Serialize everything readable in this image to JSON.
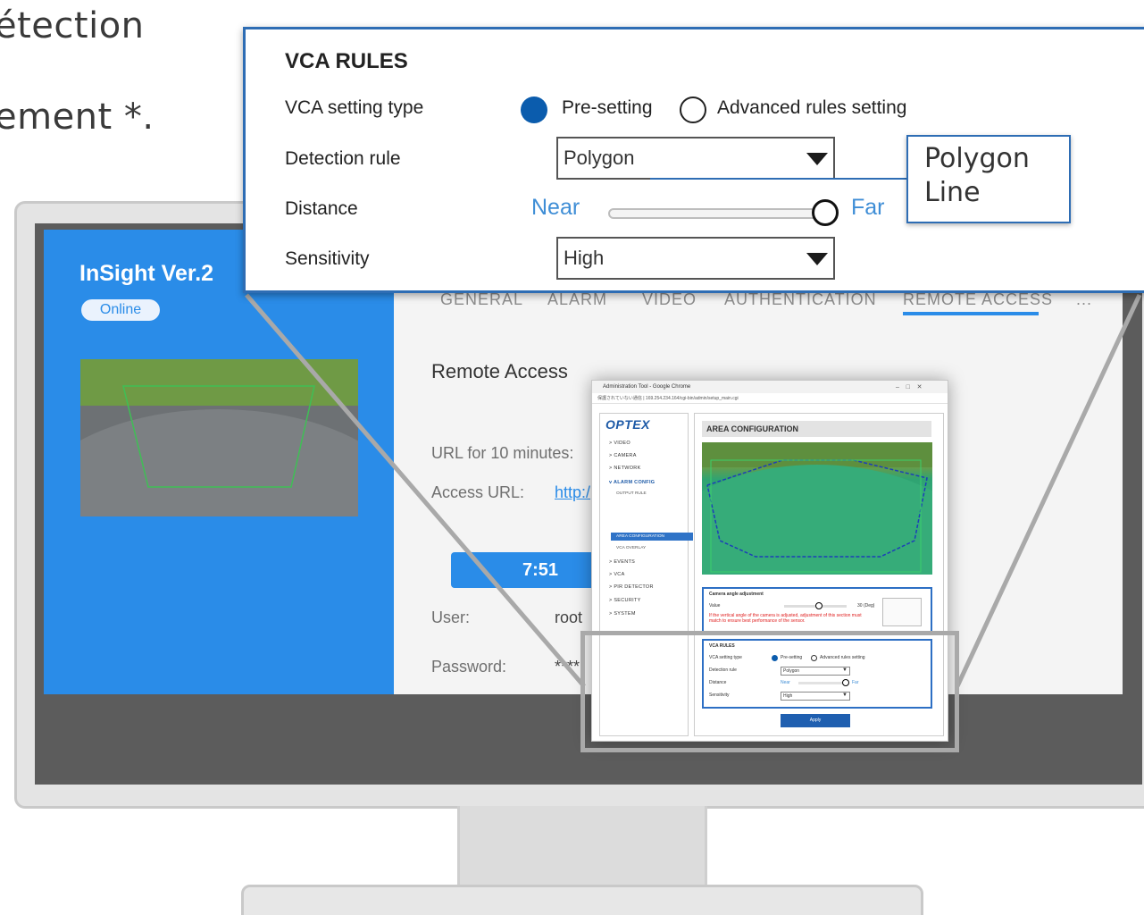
{
  "background": {
    "text_line1": "étection",
    "text_line2": "ement *."
  },
  "app": {
    "title": "InSight Ver.2",
    "status": "Online",
    "tabs": [
      "GENERAL",
      "ALARM",
      "VIDEO",
      "AUTHENTICATION",
      "REMOTE ACCESS",
      "..."
    ],
    "section_title": "Remote Access",
    "url_label": "URL for 10 minutes:",
    "access_url_label": "Access URL:",
    "access_url_value": "http:/",
    "timer": "7:51",
    "user_label": "User:",
    "user_value": "root",
    "password_label": "Password:",
    "password_value": "****"
  },
  "browser": {
    "window_title": "Administration Tool - Google Chrome",
    "address": "保護されていない通信 | 169.254.234.164/cgi-bin/admin/setup_main.cgi",
    "logo": "OPTEX",
    "nav": [
      {
        "label": "> VIDEO",
        "sub": false
      },
      {
        "label": "> CAMERA",
        "sub": false
      },
      {
        "label": "> NETWORK",
        "sub": false
      },
      {
        "label": "v ALARM CONFIG",
        "sub": false
      },
      {
        "label": "OUTPUT RULE",
        "sub": true
      },
      {
        "label": "AREA CONFIGURATION",
        "sub": true
      },
      {
        "label": "VCA OVERLAY",
        "sub": true
      },
      {
        "label": "> EVENTS",
        "sub": false
      },
      {
        "label": "> VCA",
        "sub": false
      },
      {
        "label": "> PIR DETECTOR",
        "sub": false
      },
      {
        "label": "> SECURITY",
        "sub": false
      },
      {
        "label": "> SYSTEM",
        "sub": false
      }
    ],
    "area_title": "AREA CONFIGURATION",
    "camera_angle_title": "Camera angle adjustment",
    "value_label": "Value",
    "deg_label": "30 (Deg)",
    "warning": "If the vertical angle of the camera is adjusted, adjustment of this section must match to ensure best performance of the sensor.",
    "mini_vca_title": "VCA RULES",
    "mini_rows": [
      "VCA setting type",
      "Detection rule",
      "Distance",
      "Sensitivity"
    ],
    "mini_presetting": "Pre-setting",
    "mini_advanced": "Advanced rules setting",
    "mini_polygon": "Polygon",
    "mini_near": "Near",
    "mini_far": "Far",
    "mini_high": "High",
    "apply_label": "Apply"
  },
  "vca_rules": {
    "title": "VCA RULES",
    "setting_type_label": "VCA setting type",
    "option_presetting": "Pre-setting",
    "option_advanced": "Advanced rules setting",
    "selected_option": "Pre-setting",
    "detection_rule_label": "Detection rule",
    "detection_rule_value": "Polygon",
    "distance_label": "Distance",
    "near_label": "Near",
    "far_label": "Far",
    "distance_value_fraction": 1.0,
    "sensitivity_label": "Sensitivity",
    "sensitivity_value": "High",
    "dropdown_options": [
      "Polygon",
      "Line"
    ]
  },
  "colors": {
    "accent_blue": "#2a8ce8",
    "panel_border": "#2e6db4",
    "radio_selected": "#0b5cad",
    "near_far_text": "#3f8ed6"
  }
}
